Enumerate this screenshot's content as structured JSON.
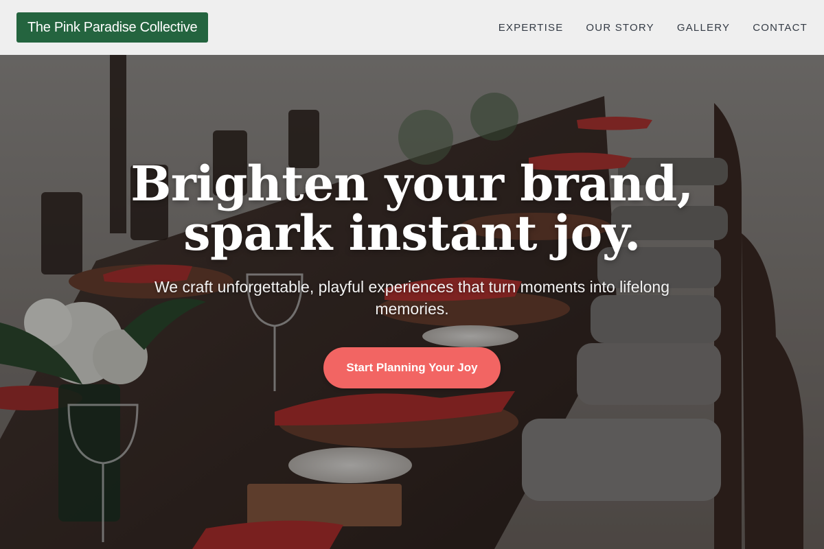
{
  "header": {
    "brand": "The Pink Paradise Collective",
    "nav": [
      "EXPERTISE",
      "OUR STORY",
      "GALLERY",
      "CONTACT"
    ]
  },
  "hero": {
    "headline_line1": "Brighten your brand,",
    "headline_line2": "spark instant joy.",
    "subheadline": "We craft unforgettable, playful experiences that turn moments into lifelong memories.",
    "cta_label": "Start Planning Your Joy",
    "background_image": "outdoor-dining-table-photo"
  },
  "colors": {
    "brand_green": "#24643f",
    "cta_coral": "#f26563",
    "header_bg": "#f4f4f4",
    "nav_text": "#333a44"
  }
}
